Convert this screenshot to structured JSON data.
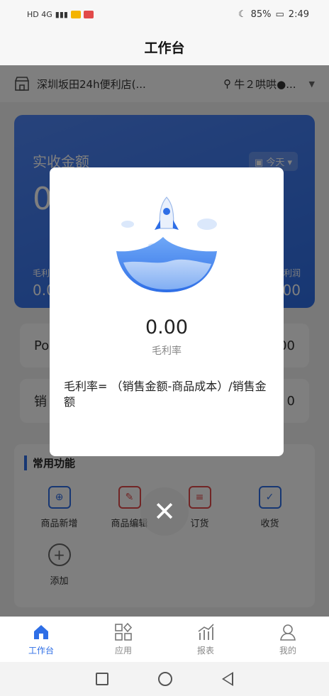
{
  "status_bar": {
    "network": "HD 4G",
    "battery": "85%",
    "time": "2:49"
  },
  "header": {
    "title": "工作台"
  },
  "store_bar": {
    "store_name": "深圳坂田24h便利店(...",
    "user_name": "牛２哄哄●..."
  },
  "summary_card": {
    "title": "实收金额",
    "amount": "0",
    "range": "今天",
    "left_label": "毛利",
    "left_value": "0.0",
    "right_label": "利润",
    "right_value": ".00"
  },
  "info_rows": [
    {
      "label": "Po",
      "value": "00"
    },
    {
      "label": "销",
      "value": "0"
    }
  ],
  "functions": {
    "title": "常用功能",
    "items": [
      {
        "label": "商品新增",
        "icon": "product-add-icon"
      },
      {
        "label": "商品编辑",
        "icon": "product-edit-icon"
      },
      {
        "label": "订货",
        "icon": "order-icon"
      },
      {
        "label": "收货",
        "icon": "receive-icon"
      },
      {
        "label": "添加",
        "icon": "add-circle-icon"
      }
    ]
  },
  "modal": {
    "value": "0.00",
    "label": "毛利率",
    "formula": "毛利率=  （销售金额-商品成本）/销售金额"
  },
  "tabbar": {
    "items": [
      {
        "label": "工作台",
        "icon": "home-icon",
        "active": true
      },
      {
        "label": "应用",
        "icon": "apps-icon",
        "active": false
      },
      {
        "label": "报表",
        "icon": "report-icon",
        "active": false
      },
      {
        "label": "我的",
        "icon": "profile-icon",
        "active": false
      }
    ]
  },
  "colors": {
    "accent": "#2e6ee6",
    "danger": "#e24a4a"
  }
}
